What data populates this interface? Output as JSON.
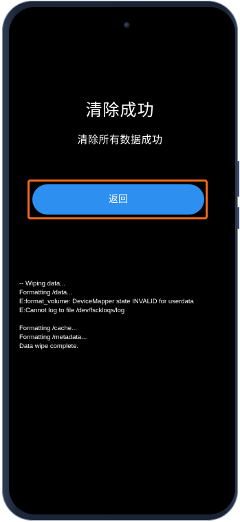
{
  "screen": {
    "title": "清除成功",
    "subtitle": "清除所有数据成功",
    "back_button_label": "返回"
  },
  "log": {
    "group1": [
      "-- Wiping data...",
      "Formatting /data...",
      "E:format_volume: DeviceMapper state INVALID for userdata",
      "E:Cannot log to file /dev/fsckloqs/log"
    ],
    "group2": [
      "Formatting /cache...",
      "Formatting /metadata...",
      "Data wipe complete."
    ]
  },
  "colors": {
    "button_bg": "#2d8ff0",
    "highlight_border": "#f26a1b",
    "screen_bg": "#000000",
    "frame": "#1c2638"
  }
}
